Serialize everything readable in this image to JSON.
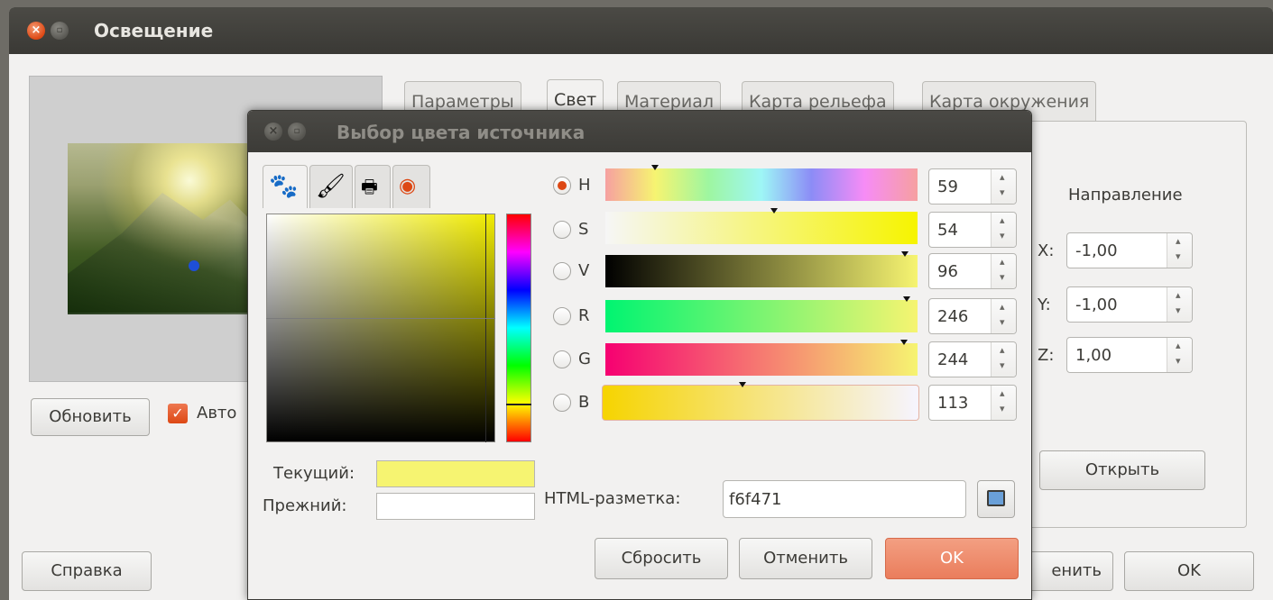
{
  "main_window": {
    "title": "Освещение",
    "close_glyph": "×",
    "min_glyph": "▫",
    "tabs": [
      "Параметры",
      "Свет",
      "Материал",
      "Карта рельефа",
      "Карта окружения"
    ],
    "active_tab": "Свет",
    "update_button": "Обновить",
    "auto_label": "Авто",
    "auto_checked": true,
    "direction_label": "Направление",
    "x_label": "X:",
    "x_value": "-1,00",
    "y_label": "Y:",
    "y_value": "-1,00",
    "z_label": "Z:",
    "z_value": "1,00",
    "open_button": "Открыть",
    "help_button": "Справка",
    "apply_button_partial": "енить",
    "ok_button": "OK"
  },
  "color_dialog": {
    "title": "Выбор цвета источника",
    "selector_tabs": [
      "gimp-wilber-icon",
      "paintbrush-icon",
      "printer-icon",
      "color-wheel-icon"
    ],
    "channels": [
      {
        "label": "H",
        "value": "59",
        "selected": true,
        "marker": 0.16
      },
      {
        "label": "S",
        "value": "54",
        "selected": false,
        "marker": 0.54
      },
      {
        "label": "V",
        "value": "96",
        "selected": false,
        "marker": 0.96
      },
      {
        "label": "R",
        "value": "246",
        "selected": false,
        "marker": 0.965
      },
      {
        "label": "G",
        "value": "244",
        "selected": false,
        "marker": 0.957
      },
      {
        "label": "B",
        "value": "113",
        "selected": false,
        "marker": 0.443
      }
    ],
    "current_label": "Текущий:",
    "previous_label": "Прежний:",
    "current_color": "#f6f471",
    "previous_color": "#ffffff",
    "html_label": "HTML-разметка:",
    "html_value": "f6f471",
    "reset_button": "Сбросить",
    "cancel_button": "Отменить",
    "ok_button": "OK"
  },
  "colors": {
    "accent": "#dd4814",
    "titlebar": "#3c3b37",
    "window_bg": "#f2f1f0"
  }
}
